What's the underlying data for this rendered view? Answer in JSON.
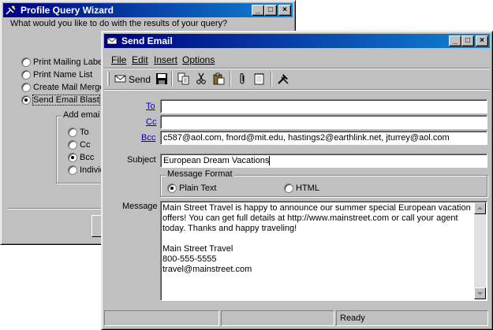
{
  "wizard": {
    "title": "Profile Query Wizard",
    "question": "What would you like to do with the results of your query?",
    "options": [
      "Print Mailing Label",
      "Print Name List",
      "Create Mail Merge",
      "Send Email Blast"
    ],
    "selected_option": 3,
    "address_group_label": "Add emai",
    "address_options": [
      "To",
      "Cc",
      "Bcc",
      "Individ"
    ],
    "selected_address": 2
  },
  "email": {
    "title": "Send Email",
    "menu": [
      "File",
      "Edit",
      "Insert",
      "Options"
    ],
    "toolbar": {
      "send_label": "Send"
    },
    "labels": {
      "to": "To",
      "cc": "Cc",
      "bcc": "Bcc",
      "subject": "Subject",
      "message": "Message"
    },
    "to_value": "",
    "cc_value": "",
    "bcc_value": "c587@aol.com, fnord@mit.edu, hastings2@earthlink.net, jturrey@aol.com",
    "subject_value": "European Dream Vacations",
    "format": {
      "legend": "Message Format",
      "plain": "Plain Text",
      "html": "HTML",
      "selected": "plain"
    },
    "message_lines": [
      "Main Street Travel is happy to announce our summer special European vacation",
      "offers! You can get full details at http://www.mainstreet.com or call your agent",
      "today. Thanks and happy traveling!",
      "",
      "Main Street Travel",
      "800-555-5555",
      "travel@mainstreet.com"
    ],
    "status": {
      "ready": "Ready"
    }
  }
}
